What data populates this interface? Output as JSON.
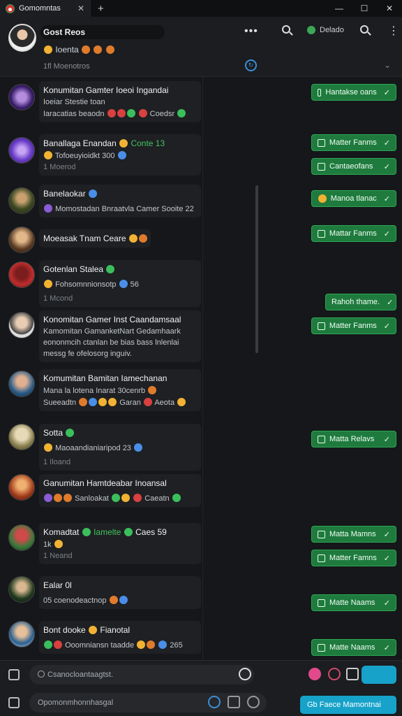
{
  "window": {
    "tab_title": "Gomomntas",
    "close": "✕",
    "new_tab": "+",
    "minimize": "—",
    "maximize": "☐",
    "close_window": "✕"
  },
  "header": {
    "name": "Gost Reos",
    "status": "Ioenta",
    "sub": "1fl Moenotros",
    "more": "•••",
    "online_label": "Delado",
    "more2": "⋮"
  },
  "chats": [
    {
      "name": "Konumitan Gamter Ioeoi Ingandai",
      "l1": "Ioeiar Stestie toan",
      "l2": "Iaracatias beaodn",
      "l2b": "Coedsr",
      "action": "Hantakse oans"
    },
    {
      "name": "Banallaga Enandan",
      "green": "Conte 13",
      "l1": "Tofoeuyioidkt 300",
      "meta": "1 Moerod",
      "action": "Matter Fanms",
      "action2": "Cantaeofans"
    },
    {
      "name": "Banelaokar",
      "l1": "Momostadan Bnraatvla Camer Sooite 22",
      "action": "Manoa tlanac"
    },
    {
      "name": "Moeasak Tnam Ceare",
      "action": "Mattar Fanms"
    },
    {
      "name": "Gotenlan Stalea",
      "l1": "Fohsomnnionsotp",
      "l1b": "56",
      "meta": "1 Mcond",
      "action": "Rahoh thame."
    },
    {
      "name": "Konomitan Gamer Inst Caandamsaal",
      "l1": "Kamomitan GamanketNart Gedamhaark",
      "l2": "eononmcih ctanlan be bias bass lnlenlai",
      "l3": "messg fe ofelosorg inguiv.",
      "action": "Matter Fanms"
    },
    {
      "name": "Komumitan Bamitan Iamechanan",
      "l1": "Mana la lotena Inarat 30cenrb",
      "l2": "Sueeadtn",
      "l2b": "Garan",
      "l2c": "Aeota",
      "action": ""
    },
    {
      "name": "Sotta",
      "l1": "Maoaandianiaripod 23",
      "meta": "1 Iloand",
      "action": "Matta Relavs"
    },
    {
      "name": "Ganumitan Hamtdeabar Inoansal",
      "l1": "Sanloakat",
      "l1b": "Caeatn",
      "action": ""
    },
    {
      "name": "Komadtat",
      "green": "Iamelte",
      "name2": "Caes 59",
      "l1": "1k",
      "meta": "1 Neand",
      "action": "Matta Mamns",
      "action2": "Matter Famns"
    },
    {
      "name": "Ealar 0l",
      "l1": "05 coenodeactnop",
      "action": "Matte Naams"
    },
    {
      "name": "Bont dooke",
      "name2": "Fianotal",
      "l1": "Ooomniansn taadde",
      "l1b": "265",
      "action": "Matte Naams"
    }
  ],
  "composer": {
    "placeholder_top": "Csanocloantaagtst.",
    "placeholder_bottom": "Opomonmhonnhasgal",
    "send_label": "Gb Faece Mamontnai"
  }
}
